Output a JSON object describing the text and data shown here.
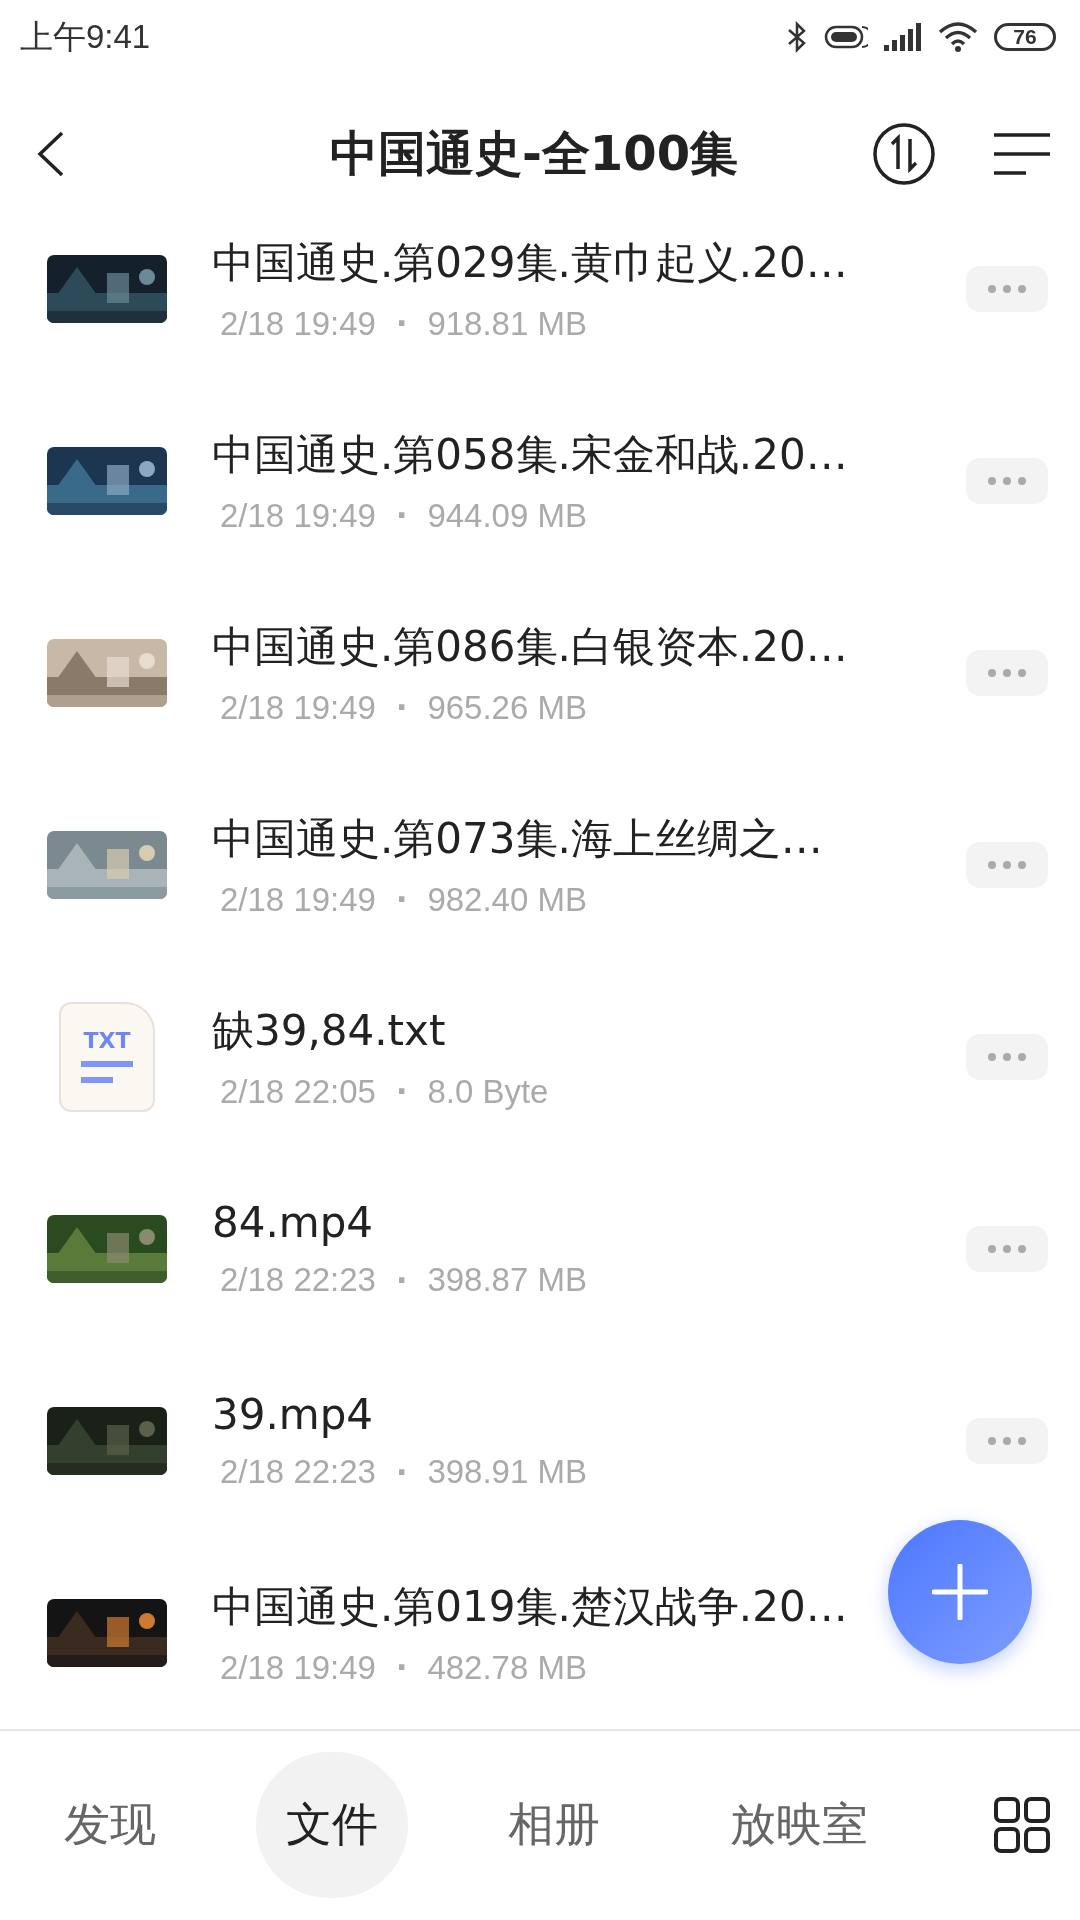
{
  "status_bar": {
    "time": "上午9:41",
    "battery": "76"
  },
  "header": {
    "title": "中国通史-全100集"
  },
  "files": [
    {
      "kind": "video",
      "name": "中国通史.第029集.黄巾起义.20…",
      "date": "2/18 19:49",
      "size": "918.81 MB"
    },
    {
      "kind": "video",
      "name": "中国通史.第058集.宋金和战.20…",
      "date": "2/18 19:49",
      "size": "944.09 MB"
    },
    {
      "kind": "video",
      "name": "中国通史.第086集.白银资本.20…",
      "date": "2/18 19:49",
      "size": "965.26 MB"
    },
    {
      "kind": "video",
      "name": "中国通史.第073集.海上丝绸之…",
      "date": "2/18 19:49",
      "size": "982.40 MB"
    },
    {
      "kind": "txt",
      "icon_label": "TXT",
      "name": "缺39,84.txt",
      "date": "2/18 22:05",
      "size": "8.0 Byte"
    },
    {
      "kind": "video",
      "name": "84.mp4",
      "date": "2/18 22:23",
      "size": "398.87 MB"
    },
    {
      "kind": "video",
      "name": "39.mp4",
      "date": "2/18 22:23",
      "size": "398.91 MB"
    },
    {
      "kind": "video",
      "name": "中国通史.第019集.楚汉战争.20…",
      "date": "2/18 19:49",
      "size": "482.78 MB"
    }
  ],
  "separator": "·",
  "tabs": [
    {
      "label": "发现",
      "selected": false
    },
    {
      "label": "文件",
      "selected": true
    },
    {
      "label": "相册",
      "selected": false
    },
    {
      "label": "放映室",
      "selected": false
    }
  ]
}
